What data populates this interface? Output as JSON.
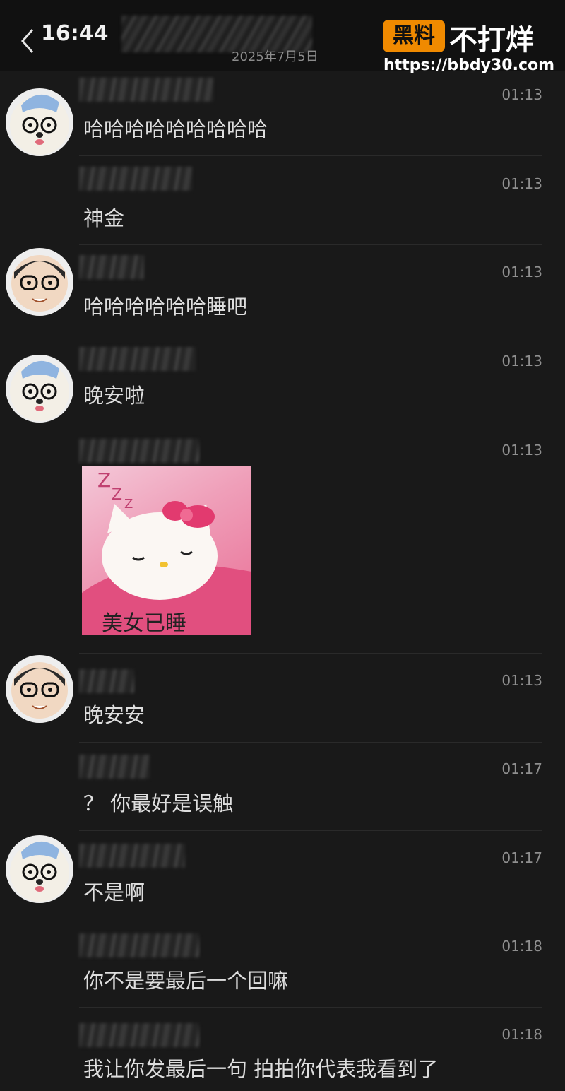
{
  "header": {
    "time": "16:44",
    "date": "2025年7月5日"
  },
  "watermark": {
    "logo_text": "黑料",
    "brand_text": "不打烊",
    "url": "https://bbdy30.com"
  },
  "messages": [
    {
      "time": "01:13",
      "text": "哈哈哈哈哈哈哈哈哈",
      "avatar": "dog"
    },
    {
      "time": "01:13",
      "text": "神金",
      "avatar": ""
    },
    {
      "time": "01:13",
      "text": "哈哈哈哈哈哈睡吧",
      "avatar": "memoji"
    },
    {
      "time": "01:13",
      "text": "晚安啦",
      "avatar": "dog"
    },
    {
      "time": "01:13",
      "sticker_caption": "美女已睡",
      "avatar": ""
    },
    {
      "time": "01:13",
      "text": "晚安安",
      "avatar": "memoji"
    },
    {
      "time": "01:17",
      "text": "？ 你最好是误触",
      "avatar": ""
    },
    {
      "time": "01:17",
      "text": "不是啊",
      "avatar": "dog"
    },
    {
      "time": "01:18",
      "text": "你不是要最后一个回嘛",
      "avatar": ""
    },
    {
      "time": "01:18",
      "text": "我让你发最后一句 拍拍你代表我看到了",
      "avatar": ""
    }
  ],
  "colors": {
    "background": "#191919",
    "brand_orange": "#f08a00"
  }
}
